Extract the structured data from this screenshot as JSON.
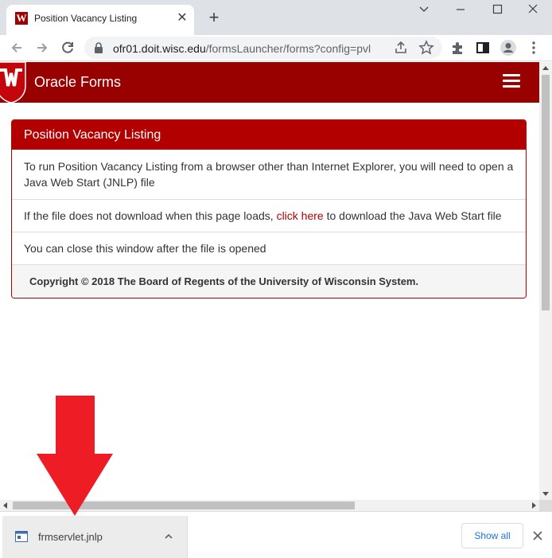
{
  "tab": {
    "title": "Position Vacancy Listing",
    "favicon_letter": "W"
  },
  "toolbar": {
    "url_host": "ofr01.doit.wisc.edu",
    "url_path": "/formsLauncher/forms?config=pvl"
  },
  "page": {
    "brand": "Oracle Forms",
    "panel": {
      "heading": "Position Vacancy Listing",
      "row1": "To run Position Vacancy Listing from a browser other than Internet Explorer, you will need to open a Java Web Start (JNLP) file",
      "row2_before": "If the file does not download when this page loads, ",
      "row2_link": "click here",
      "row2_after": " to download the Java Web Start file",
      "row3": "You can close this window after the file is opened",
      "footer": "Copyright © 2018 The Board of Regents of the University of Wisconsin System."
    }
  },
  "download": {
    "filename": "frmservlet.jnlp",
    "show_all": "Show all"
  },
  "colors": {
    "brand_red": "#990000",
    "panel_red": "#b20000",
    "arrow_red": "#ee1c25",
    "link_blue": "#1a73e8"
  }
}
